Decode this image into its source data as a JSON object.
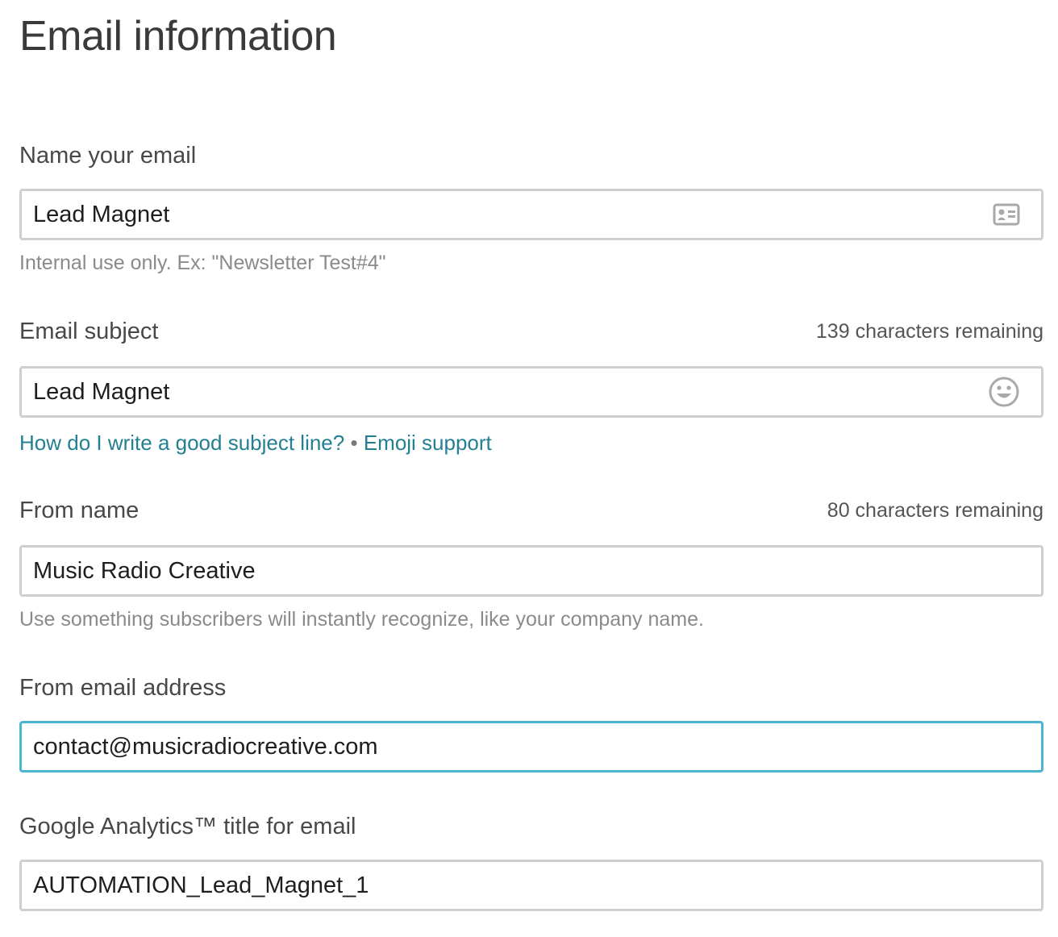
{
  "page": {
    "title": "Email information"
  },
  "name_email": {
    "label": "Name your email",
    "value": "Lead Magnet",
    "help": "Internal use only. Ex: \"Newsletter Test#4\"",
    "icon": "contact-card-icon"
  },
  "subject": {
    "label": "Email subject",
    "counter": "139 characters remaining",
    "value": "Lead Magnet",
    "icon": "emoji-smiley-icon",
    "help_link": "How do I write a good subject line?",
    "separator": "•",
    "emoji_link": "Emoji support"
  },
  "from_name": {
    "label": "From name",
    "counter": "80 characters remaining",
    "value": "Music Radio Creative",
    "help": "Use something subscribers will instantly recognize, like your company name."
  },
  "from_email": {
    "label": "From email address",
    "value": "contact@musicradiocreative.com",
    "focused": true
  },
  "analytics": {
    "label": "Google Analytics™ title for email",
    "value": "AUTOMATION_Lead_Magnet_1"
  },
  "colors": {
    "link": "#237f92",
    "focus_border": "#4ab6d0",
    "field_border": "#cfcfcf"
  }
}
